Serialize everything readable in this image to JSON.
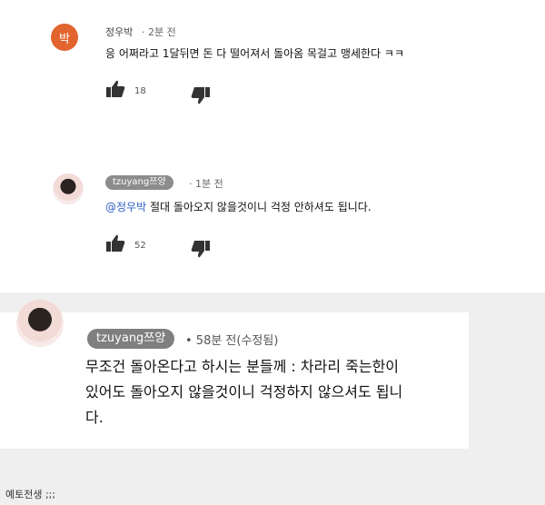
{
  "comment1": {
    "avatar_letter": "박",
    "author": "정우박",
    "time": "· 2분 전",
    "text": "응 어쩌라고 1달뒤면 돈 다 떨어져서 돌아옴 목걸고 맹세한다 ㅋㅋ",
    "likes": "18",
    "avatar_color": "#e2642f"
  },
  "reply": {
    "author_badge": "tzuyang쯔양",
    "time": "· 1분 전",
    "mention": "@정우박",
    "text": " 절대 돌아오지 않을것이니 걱정 안하셔도 됩니다.",
    "likes": "52"
  },
  "zoomed_comment": {
    "author_badge": "tzuyang쯔양",
    "time": "• 58분 전(수정됨)",
    "line1": "무조건 돌아온다고 하시는 분들께 : 차라리 죽는한이",
    "line2": "있어도 돌아오지 않을것이니 걱정하지 않으셔도 됩니",
    "line3": "다."
  },
  "caption": "예토전생 ;;;",
  "icons": [
    "thumbs-up-icon",
    "thumbs-down-icon"
  ]
}
